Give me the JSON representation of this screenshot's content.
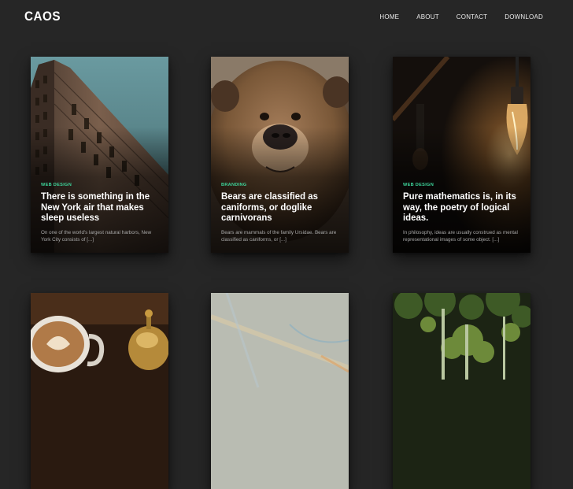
{
  "site": {
    "logo": "CAOS"
  },
  "nav": {
    "items": [
      "HOME",
      "ABOUT",
      "CONTACT",
      "DOWNLOAD"
    ]
  },
  "posts": [
    {
      "category": "WEB DESIGN",
      "title": "There is something in the New York air that makes sleep useless",
      "excerpt": "On one of the world's largest natural harbors, New York City consists of [...]",
      "image_icon": "flatiron-building-photo"
    },
    {
      "category": "BRANDING",
      "title": "Bears are classified as caniforms, or doglike carnivorans",
      "excerpt": "Bears are mammals of the family Ursidae. Bears are classified as caniforms, or [...]",
      "image_icon": "brown-bear-photo"
    },
    {
      "category": "WEB DESIGN",
      "title": "Pure mathematics is, in its way, the poetry of logical ideas.",
      "excerpt": "In philosophy, ideas are usually construed as mental representational images of some object. [...]",
      "image_icon": "light-bulb-photo"
    },
    {
      "image_icon": "latte-coffee-photo"
    },
    {
      "image_icon": "paper-map-photo"
    },
    {
      "image_icon": "forest-trees-photo"
    }
  ],
  "colors": {
    "background": "#262626",
    "accent": "#3dd49a"
  }
}
